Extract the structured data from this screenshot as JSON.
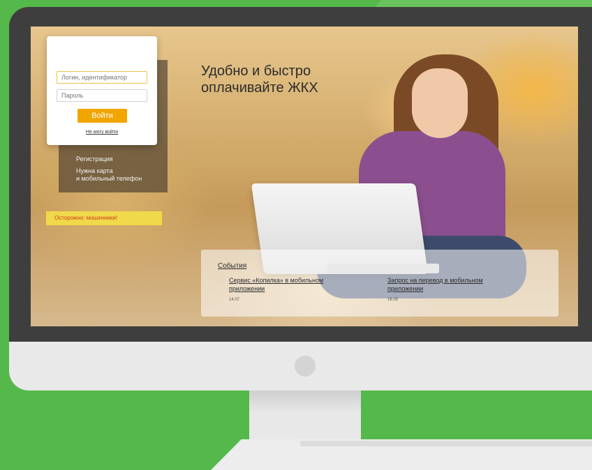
{
  "login": {
    "login_placeholder": "Логин, идентификатор",
    "password_placeholder": "Пароль",
    "login_button": "Войти",
    "forgot_link": "Не могу войти"
  },
  "register_link": "Регистрация",
  "need_card_line1": "Нужна карта",
  "need_card_line2": "и мобильный телефон",
  "fraud_banner": "Осторожно: мошенники!",
  "headline_line1": "Удобно и быстро",
  "headline_line2": "оплачивайте ЖКХ",
  "events": {
    "title": "События",
    "items": [
      {
        "title": "Сервис «Копилка» в мобильном приложении",
        "date": "14.07"
      },
      {
        "title": "Запрос на перевод в мобильном приложении",
        "date": "16.05"
      }
    ]
  },
  "colors": {
    "background_green": "#55b84a",
    "accent_orange": "#f0a500",
    "fraud_yellow": "#f0d94a",
    "fraud_text_red": "#d23a1f"
  }
}
